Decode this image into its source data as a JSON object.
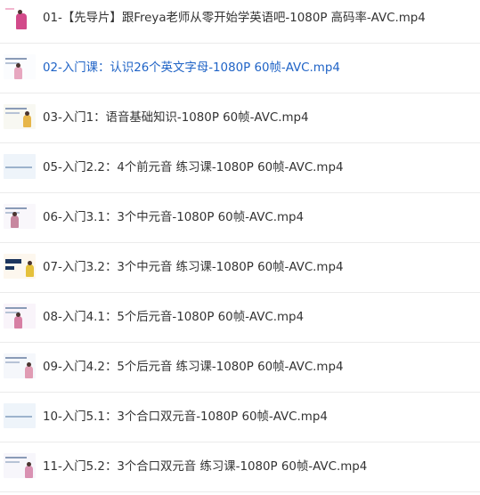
{
  "files": [
    {
      "name": "01-【先导片】跟Freya老师从零开始学英语吧-1080P 高码率-AVC.mp4",
      "selected": false
    },
    {
      "name": "02-入门课：认识26个英文字母-1080P 60帧-AVC.mp4",
      "selected": true
    },
    {
      "name": "03-入门1：语音基础知识-1080P 60帧-AVC.mp4",
      "selected": false
    },
    {
      "name": "05-入门2.2：4个前元音 练习课-1080P 60帧-AVC.mp4",
      "selected": false
    },
    {
      "name": "06-入门3.1：3个中元音-1080P 60帧-AVC.mp4",
      "selected": false
    },
    {
      "name": "07-入门3.2：3个中元音 练习课-1080P 60帧-AVC.mp4",
      "selected": false
    },
    {
      "name": "08-入门4.1：5个后元音-1080P 60帧-AVC.mp4",
      "selected": false
    },
    {
      "name": "09-入门4.2：5个后元音 练习课-1080P 60帧-AVC.mp4",
      "selected": false
    },
    {
      "name": "10-入门5.1：3个合口双元音-1080P 60帧-AVC.mp4",
      "selected": false
    },
    {
      "name": "11-入门5.2：3个合口双元音 练习课-1080P 60帧-AVC.mp4",
      "selected": false
    }
  ],
  "colors": {
    "selected_text": "#1f63c6",
    "text": "#333333",
    "divider": "#ebebeb"
  }
}
